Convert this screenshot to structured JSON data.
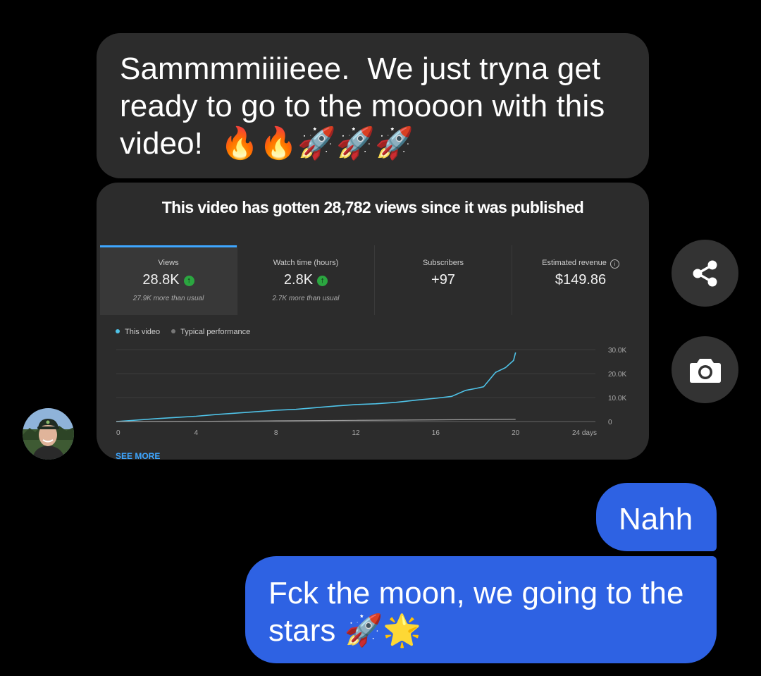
{
  "messages": {
    "incoming_1": "Sammmmiiiieee.  We just tryna get ready to go to the moooon with this video!  🔥🔥🚀🚀🚀",
    "outgoing_1": "Nahh",
    "outgoing_2": "Fck the moon, we going to the stars 🚀🌟"
  },
  "card": {
    "title": "This video has gotten 28,782 views since it was published",
    "metrics": [
      {
        "label": "Views",
        "value": "28.8K",
        "note": "27.9K more than usual",
        "trend": "up"
      },
      {
        "label": "Watch time (hours)",
        "value": "2.8K",
        "note": "2.7K more than usual",
        "trend": "up"
      },
      {
        "label": "Subscribers",
        "value": "+97",
        "note": ""
      },
      {
        "label": "Estimated revenue",
        "value": "$149.86",
        "note": ""
      }
    ],
    "legend": {
      "this_video": "This video",
      "typical": "Typical performance"
    },
    "see_more": "SEE MORE"
  },
  "chart_data": {
    "type": "line",
    "x_ticks": [
      "0",
      "4",
      "8",
      "12",
      "16",
      "20",
      "24 days"
    ],
    "y_ticks": [
      "30.0K",
      "20.0K",
      "10.0K",
      "0"
    ],
    "xlim": [
      0,
      24
    ],
    "ylim": [
      0,
      30000
    ],
    "grid": true,
    "legend_placement": "top-left",
    "series": [
      {
        "name": "This video",
        "color": "#4fc3e8",
        "x": [
          0,
          1,
          2,
          3,
          4,
          5,
          6,
          7,
          8,
          9,
          10,
          11,
          12,
          13,
          14,
          15,
          16,
          16.8,
          17.5,
          18,
          18.4,
          18.7,
          19,
          19.5,
          19.9,
          20
        ],
        "y": [
          0,
          600,
          1200,
          1700,
          2200,
          2900,
          3500,
          4100,
          4700,
          5100,
          5800,
          6500,
          7100,
          7400,
          8000,
          8900,
          9700,
          10500,
          13000,
          13800,
          14500,
          17500,
          20500,
          22500,
          25500,
          28800
        ]
      },
      {
        "name": "Typical performance",
        "color": "#9e9e9e",
        "x": [
          0,
          4,
          8,
          12,
          16,
          20
        ],
        "y": [
          0,
          100,
          300,
          500,
          700,
          900
        ]
      }
    ]
  },
  "colors": {
    "incoming_bubble": "#2c2c2c",
    "outgoing_bubble": "#2e62e3",
    "accent_blue": "#3ea6ff",
    "trend_up_green": "#2ba640"
  },
  "icons": {
    "share": "share-icon",
    "camera": "camera-icon",
    "trend_up": "arrow-up-icon",
    "info": "info-icon"
  }
}
